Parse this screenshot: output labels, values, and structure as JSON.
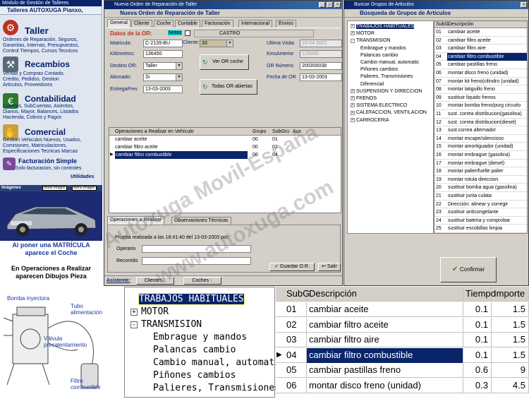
{
  "left": {
    "title": "Módulo de Gestión de Talleres",
    "subtitle": "Talleres AUTOXUGA Pianxo,",
    "sections": [
      {
        "name": "Taller",
        "desc": [
          "Ordenes de Reparación, Seguros,",
          "Garantias, Internas, Presupuestos,",
          "Control Tiempos, Cursos Tecnicos"
        ]
      },
      {
        "name": "Recambios",
        "desc": [
          "Ventas y Compras Contado,",
          "Crédito, Pedidos,   Gestion",
          "Articulos, Proveedores"
        ]
      },
      {
        "name": "Contabilidad",
        "desc": [
          "Cuentas, SubCuentas, Asientos,",
          "Diarios, Mayor, Balances, Listados",
          "Hacienda, Cobros y Pagos"
        ]
      },
      {
        "name": "Comercial",
        "desc": [
          "Gestion Vehiculos Nuevos, Usados,",
          "Comisiones, Matriculaciones,",
          "Especificaciones Tecnicas Marcas"
        ]
      }
    ],
    "facturacion": "Facturación Simple",
    "facturacion_desc": "Solo facturacion, sin controles",
    "utilidades": "Utilidades",
    "imagenes": "Imágenes",
    "modo1": "Modo Imagen",
    "modo2": "Menu Imagen",
    "caption1a": "Al poner una ",
    "caption1b": "MATRÍCULA",
    "caption1c": "aparece el Coche",
    "caption2": "En Operaciones a Realizar aparecen Dibujos Pieza",
    "parts": [
      "Bomba inyectora",
      "Tubo alimentación",
      "Válvula precalentamiento",
      "Filtro combustible"
    ]
  },
  "order": {
    "title": "Nueva Orden de Reparación de Taller",
    "subtitle": "Nueva Orden de Reparación de Taller",
    "tabs": [
      "General",
      "Cliente",
      "Coche",
      "Contable",
      "Facturación",
      "Internacional",
      "Envios"
    ],
    "datos": "Datos de la OR:",
    "notas": "Notas",
    "castro": "CASTRO",
    "matricula_lbl": "Matricula:",
    "matricula": "C-2139-BU",
    "cliente_lbl": "Cliente:",
    "cliente": "33",
    "km_lbl": "Kilómetros:",
    "km": "136450",
    "destino_lbl": "Destino OR:",
    "destino": "Taller",
    "abonado_lbl": "Abonado:",
    "abonado": "Si",
    "entrega_lbl": "EntregaPrev",
    "entrega": "13-03-2003",
    "ultima_lbl": "Ultima Visita",
    "ultima": "10-04-2001",
    "kmsant_lbl": "KmsAnterior",
    "kmsant": "125000",
    "ornum_lbl": "OR Número:",
    "ornum": "200300038",
    "fecha_lbl": "Fecha de OR",
    "fecha": "13-03-2003",
    "btn_ver": "Ver OR coche",
    "btn_todas": "Todas OR abiertas",
    "ops_headers": [
      "Operaciones a Realizar en Vehículo",
      "Grupo",
      "SubGru",
      "Aux"
    ],
    "ops": [
      [
        "cambiar aceite",
        "00",
        "01"
      ],
      [
        "cambiar filtro aceite",
        "00",
        "02"
      ],
      [
        "cambiar filtro combustible",
        "00",
        "04"
      ]
    ],
    "bottom_tabs": [
      "Operaciones a Realizar",
      "Observaciones Técnicas"
    ],
    "prueba": "Prueba realizada a las 18:41:40 del 13-03-2003 por:",
    "operario_lbl": "Operario",
    "recorrido_lbl": "Recorrido",
    "guardar": "Guardar O.R.",
    "salir": "Salir",
    "asistente": "Asistente:",
    "clientes": "Clientes",
    "coches": "Coches"
  },
  "search": {
    "title": "Buscar Grupos de Articulos",
    "subtitle": "Búsqueda de Grupos de Artículos",
    "tree": [
      {
        "label": "TRABAJOS HABITUALES",
        "sel": true,
        "lvl": 0,
        "sign": "+"
      },
      {
        "label": "MOTOR",
        "lvl": 0,
        "sign": "+"
      },
      {
        "label": "TRANSMISION",
        "lvl": 0,
        "sign": "-"
      },
      {
        "label": "Embrague y mandos",
        "lvl": 1
      },
      {
        "label": "Palancas cambio",
        "lvl": 1
      },
      {
        "label": "Cambio manual, automatic",
        "lvl": 1
      },
      {
        "label": "Piñones cambios",
        "lvl": 1
      },
      {
        "label": "Palieres, Transmisiones",
        "lvl": 1
      },
      {
        "label": "Diferencial",
        "lvl": 1
      },
      {
        "label": "SUSPENSION Y DIRECCION",
        "lvl": 0,
        "sign": "+"
      },
      {
        "label": "FRENOS",
        "lvl": 0,
        "sign": "+"
      },
      {
        "label": "SISTEMA ELECTRICO",
        "lvl": 0,
        "sign": "+"
      },
      {
        "label": "CALEFACCION, VENTILACION",
        "lvl": 0,
        "sign": "+"
      },
      {
        "label": "CARROCERIA",
        "lvl": 0,
        "sign": "+"
      }
    ],
    "headers": [
      "SubG",
      "Descripción"
    ],
    "rows": [
      [
        "01",
        "cambiar aceite"
      ],
      [
        "02",
        "cambiar filtro aceite"
      ],
      [
        "03",
        "cambiar filtro aire"
      ],
      [
        "04",
        "cambiar filtro combustible"
      ],
      [
        "05",
        "cambiar pastillas freno"
      ],
      [
        "06",
        "montar disco freno (unidad)"
      ],
      [
        "07",
        "montar kit freno(cilindro (unidad)"
      ],
      [
        "08",
        "montar latiguillo freno"
      ],
      [
        "09",
        "sustituir liquido frenos"
      ],
      [
        "10",
        "montar bomba freno/purg circuito"
      ],
      [
        "11",
        "sust. correa distribucion(gasolina)"
      ],
      [
        "12",
        "sust. correa distribucion(diesel)"
      ],
      [
        "13",
        "sust.correa alternador"
      ],
      [
        "14",
        "montar escape/silencioso"
      ],
      [
        "15",
        "montar amortiguador (unidad)"
      ],
      [
        "16",
        "montar embrague (gasolina)"
      ],
      [
        "17",
        "montar embrague (diesel)"
      ],
      [
        "18",
        "montar palier/fuelle palier"
      ],
      [
        "19",
        "montar rotula direccion"
      ],
      [
        "20",
        "sustituir bomba agua (gasolina)"
      ],
      [
        "21",
        "sustituir junta culata"
      ],
      [
        "22",
        "Dirección: alinear y corregir"
      ],
      [
        "23",
        "sustituir anticongelante"
      ],
      [
        "24",
        "sustituir bateria y comprobar"
      ],
      [
        "25",
        "sustituir escobillas limpia"
      ]
    ],
    "selected_row": 3,
    "confirmar": "Confirmar"
  },
  "zoom": {
    "tree": [
      {
        "label": "TRABAJOS HABITUALES",
        "sel": true,
        "sign": ""
      },
      {
        "label": "MOTOR",
        "sign": "+"
      },
      {
        "label": "TRANSMISION",
        "sign": "-"
      },
      {
        "label": "Embrague y mandos",
        "lvl": 1
      },
      {
        "label": "Palancas cambio",
        "lvl": 1
      },
      {
        "label": "Cambio manual, automatic",
        "lvl": 1
      },
      {
        "label": "Piñones cambios",
        "lvl": 1
      },
      {
        "label": "Palieres, Transmisiones",
        "lvl": 1
      }
    ],
    "headers": [
      "SubG",
      "Descripción",
      "Tiempo",
      "Importe"
    ],
    "rows": [
      [
        "01",
        "cambiar aceite",
        "0.1",
        "1.5"
      ],
      [
        "02",
        "cambiar filtro aceite",
        "0.1",
        "1.5"
      ],
      [
        "03",
        "cambiar filtro aire",
        "0.1",
        "1.5"
      ],
      [
        "04",
        "cambiar filtro combustible",
        "0.1",
        "1.5"
      ],
      [
        "05",
        "cambiar pastillas freno",
        "0.6",
        "9"
      ],
      [
        "06",
        "montar disco freno (unidad)",
        "0.3",
        "4.5"
      ]
    ],
    "selected_row": 3
  },
  "watermark1": "Autoxuga Movil-España",
  "watermark2": "www.autoxuga.com"
}
